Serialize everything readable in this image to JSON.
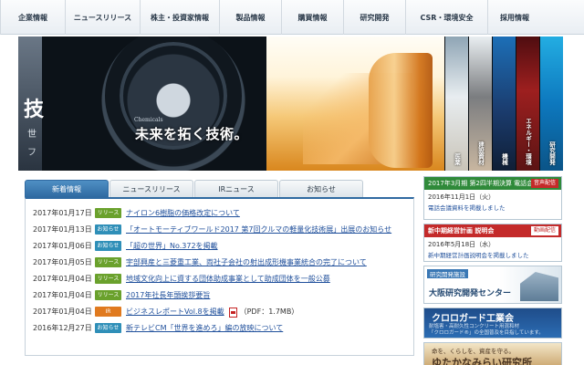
{
  "nav": {
    "items": [
      "企業情報",
      "ニュースリリース",
      "株主・投資家情報",
      "製品情報",
      "購買情報",
      "研究開発",
      "CSR・環境安全",
      "採用情報"
    ]
  },
  "hero": {
    "chemicals_label": "Chemicals",
    "tagline": "未来を拓く技術。",
    "side_char_big": "技",
    "side_char_1": "世",
    "side_char_2": "フ",
    "categories": [
      "医薬",
      "建設資材",
      "機械",
      "エネルギー・環境",
      "研究開発"
    ]
  },
  "news": {
    "tabs": [
      "新着情報",
      "ニュースリリース",
      "IRニュース",
      "お知らせ"
    ],
    "active_tab": 0,
    "items": [
      {
        "date": "2017年01月17日",
        "badge": "リリース",
        "badge_color": "#6aa12c",
        "title": "ナイロン6樹脂の価格改定について",
        "suffix": ""
      },
      {
        "date": "2017年01月13日",
        "badge": "お知らせ",
        "badge_color": "#2f8fb8",
        "title": "「オートモーティブワールド2017 第7回クルマの軽量化技術展」出展のお知らせ",
        "suffix": ""
      },
      {
        "date": "2017年01月06日",
        "badge": "お知らせ",
        "badge_color": "#2f8fb8",
        "title": "「超の世界」No.372を掲載",
        "suffix": ""
      },
      {
        "date": "2017年01月05日",
        "badge": "リリース",
        "badge_color": "#6aa12c",
        "title": "宇部興産と三菱重工業、両社子会社の射出成形機事業統合の完了について",
        "suffix": ""
      },
      {
        "date": "2017年01月04日",
        "badge": "リリース",
        "badge_color": "#6aa12c",
        "title": "地域文化向上に資する団体助成事業として助成団体を一般公募",
        "suffix": ""
      },
      {
        "date": "2017年01月04日",
        "badge": "リリース",
        "badge_color": "#6aa12c",
        "title": "2017年社長年頭挨拶要旨",
        "suffix": ""
      },
      {
        "date": "2017年01月04日",
        "badge": "IR",
        "badge_color": "#e07a1f",
        "title": "ビジネスレポートVol.8を掲載",
        "suffix": "（PDF：1.7MB）"
      },
      {
        "date": "2016年12月27日",
        "badge": "お知らせ",
        "badge_color": "#2f8fb8",
        "title": "新テレビCM「世界を進めろ」編の放映について",
        "suffix": ""
      }
    ]
  },
  "sidebar": {
    "b1": {
      "header": "2017年3月期 第2四半期決算 電話会議配信",
      "button": "音声配信",
      "line1": "2016年11月1日（火）",
      "line2": "電話会議資料を掲載しました"
    },
    "b2": {
      "header": "新中期経営計画 説明会",
      "button": "動画配信",
      "line1": "2016年5月18日（水）",
      "line2": "新中期経営計画説明会を掲載しました"
    },
    "b3": {
      "tag": "研究開発施設",
      "name": "大阪研究開発センター"
    },
    "b4": {
      "name": "クロロガード工業会",
      "sub1": "耐塩害・高耐久性コンクリート用混和材",
      "sub2": "「クロロガード®」の全国普及を目指しています。"
    },
    "b5": {
      "small": "命を、くらしを、資産を守る。",
      "big": "ゆたかなみらい研究所"
    }
  }
}
